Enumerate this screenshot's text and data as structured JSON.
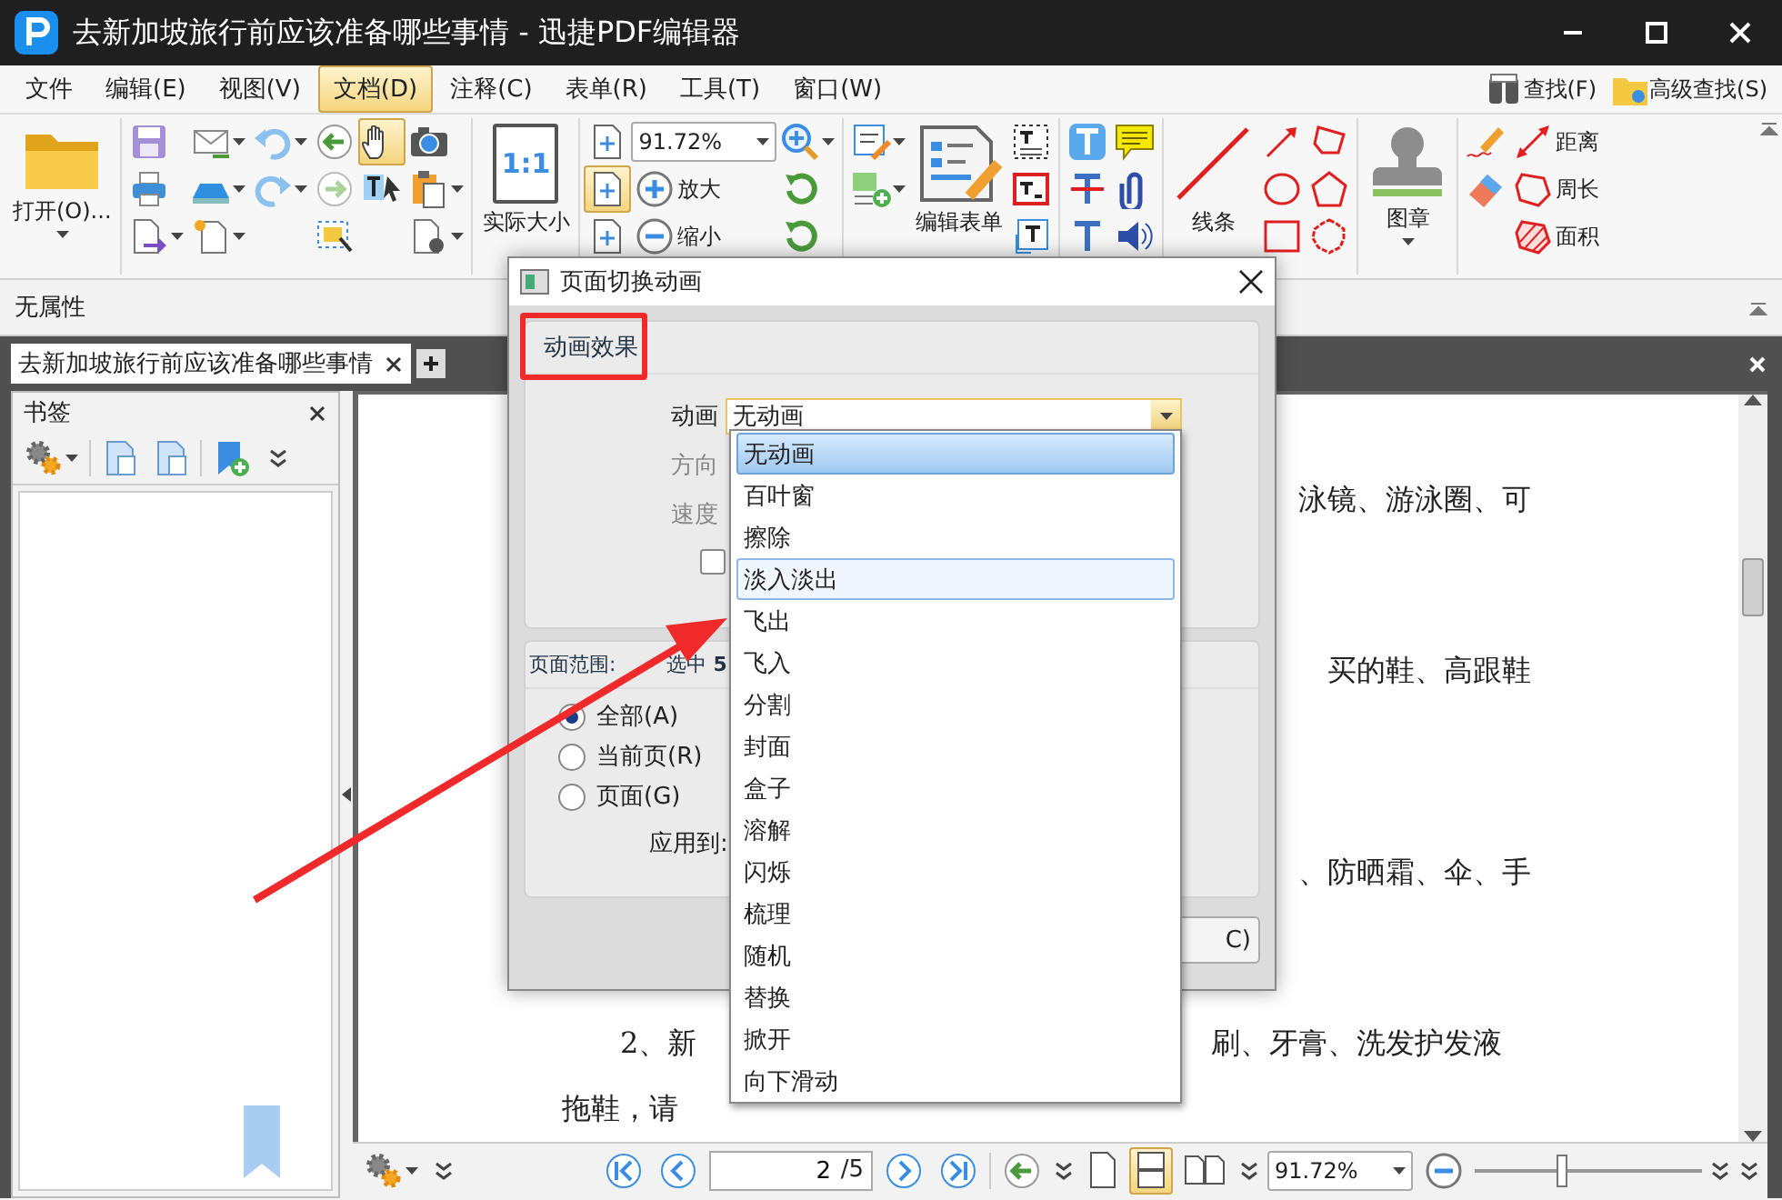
{
  "window": {
    "title": "去新加坡旅行前应该准备哪些事情  -  迅捷PDF编辑器"
  },
  "menu": [
    {
      "label": "文件",
      "selected": false
    },
    {
      "label": "编辑(E)",
      "selected": false
    },
    {
      "label": "视图(V)",
      "selected": false
    },
    {
      "label": "文档(D)",
      "selected": true
    },
    {
      "label": "注释(C)",
      "selected": false
    },
    {
      "label": "表单(R)",
      "selected": false
    },
    {
      "label": "工具(T)",
      "selected": false
    },
    {
      "label": "窗口(W)",
      "selected": false
    }
  ],
  "search_buttons": [
    "查找(F)",
    "高级查找(S)"
  ],
  "toolbar": {
    "open": "打开(O)...",
    "hand_selected": true,
    "actual_size_glyph": "1:1",
    "actual_size": "实际大小",
    "fit_selected": true,
    "zoom": "91.72%",
    "zoom_in": "放大",
    "zoom_out": "缩小",
    "edit_form": "编辑表单",
    "lines": "线条",
    "stamp": "图章",
    "measures": [
      "距离",
      "周长",
      "面积"
    ]
  },
  "property_bar": {
    "text": "无属性"
  },
  "tabs": [
    {
      "label": "去新加坡旅行前应该准备哪些事情",
      "selected": true
    }
  ],
  "bookmarks": {
    "title": "书签"
  },
  "document": {
    "lines": [
      {
        "kind": "body",
        "right": "泳镜、游泳圈、可"
      },
      {
        "kind": "body",
        "right": "买的鞋、高跟鞋"
      },
      {
        "kind": "body",
        "right": "、防晒霜、伞、手"
      },
      {
        "kind": "item",
        "left": "2、新",
        "right": "刷、牙膏、洗发护发液"
      },
      {
        "kind": "body",
        "left": "拖鞋，请"
      }
    ]
  },
  "dialog": {
    "title": "页面切换动画",
    "effects_header": "动画效果",
    "animation_label": "动画",
    "animation_value": "无动画",
    "direction_label": "方向",
    "speed_label": "速度",
    "checkbox": {
      "checked": false
    },
    "range_header_label": "页面范围:",
    "range_header_value": "选中 **5**",
    "range_options": [
      {
        "label": "全部(A)",
        "selected": true
      },
      {
        "label": "当前页(R)",
        "selected": false
      },
      {
        "label": "页面(G)",
        "selected": false
      }
    ],
    "apply_label": "应用到:",
    "button": "C)"
  },
  "dropdown": [
    {
      "label": "无动画",
      "selected": true,
      "hovered": false
    },
    {
      "label": "百叶窗",
      "selected": false,
      "hovered": false
    },
    {
      "label": "擦除",
      "selected": false,
      "hovered": false
    },
    {
      "label": "淡入淡出",
      "selected": false,
      "hovered": true
    },
    {
      "label": "飞出",
      "selected": false,
      "hovered": false
    },
    {
      "label": "飞入",
      "selected": false,
      "hovered": false
    },
    {
      "label": "分割",
      "selected": false,
      "hovered": false
    },
    {
      "label": "封面",
      "selected": false,
      "hovered": false
    },
    {
      "label": "盒子",
      "selected": false,
      "hovered": false
    },
    {
      "label": "溶解",
      "selected": false,
      "hovered": false
    },
    {
      "label": "闪烁",
      "selected": false,
      "hovered": false
    },
    {
      "label": "梳理",
      "selected": false,
      "hovered": false
    },
    {
      "label": "随机",
      "selected": false,
      "hovered": false
    },
    {
      "label": "替换",
      "selected": false,
      "hovered": false
    },
    {
      "label": "掀开",
      "selected": false,
      "hovered": false
    },
    {
      "label": "向下滑动",
      "selected": false,
      "hovered": false
    }
  ],
  "bottom_bar": {
    "page": "2",
    "total": "/5",
    "continuous_selected": true,
    "zoom": "91.72%",
    "zoom_slider": {
      "level": 0.38
    }
  }
}
